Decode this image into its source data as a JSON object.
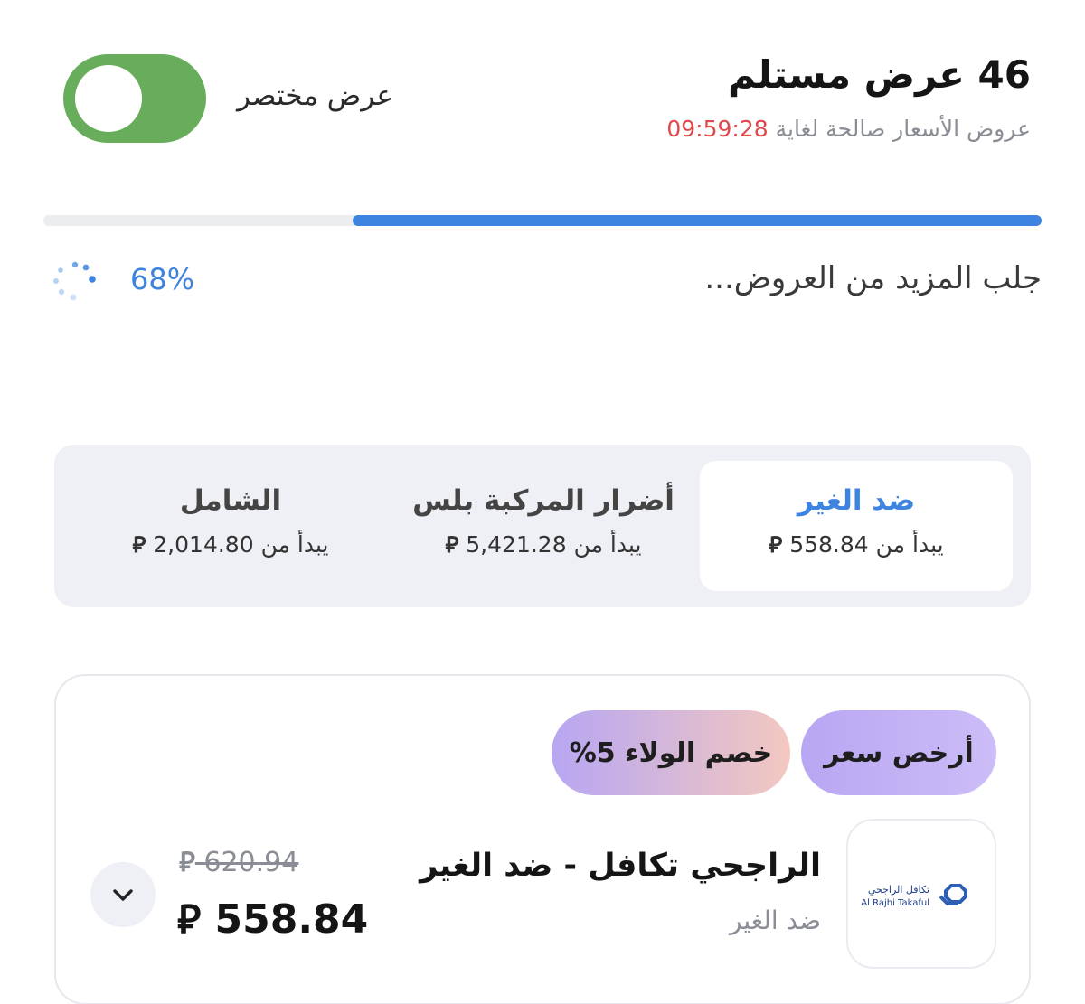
{
  "header": {
    "offers_count_title": "46 عرض مستلم",
    "validity_prefix": "عروض الأسعار صالحة لغاية",
    "validity_timer": "09:59:28",
    "compact_view_label": "عرض مختصر",
    "compact_view_on": true
  },
  "progress": {
    "fraction": 0.69,
    "loading_text": "جلب المزيد من العروض...",
    "percent_label": "68%"
  },
  "tabs": [
    {
      "title": "ضد الغير",
      "starts_from": "يبدأ من",
      "price": "558.84",
      "active": true
    },
    {
      "title": "أضرار المركبة بلس",
      "starts_from": "يبدأ من",
      "price": "5,421.28",
      "active": false
    },
    {
      "title": "الشامل",
      "starts_from": "يبدأ من",
      "price": "2,014.80",
      "active": false
    }
  ],
  "offer": {
    "badge_cheapest": "أرخص سعر",
    "badge_loyalty": "خصم الولاء 5%",
    "provider_name": "الراجحي تكافل - ضد الغير",
    "provider_sub": "ضد الغير",
    "logo_text_ar": "تكافل الراجحي",
    "logo_text_en": "Al Rajhi Takaful",
    "old_price": "620.94",
    "price": "558.84"
  },
  "currency_symbol": "⃁",
  "colors": {
    "accent": "#3d83e0",
    "toggle_on": "#67ad5b",
    "timer": "#e0484c",
    "muted": "#8a8d95"
  }
}
